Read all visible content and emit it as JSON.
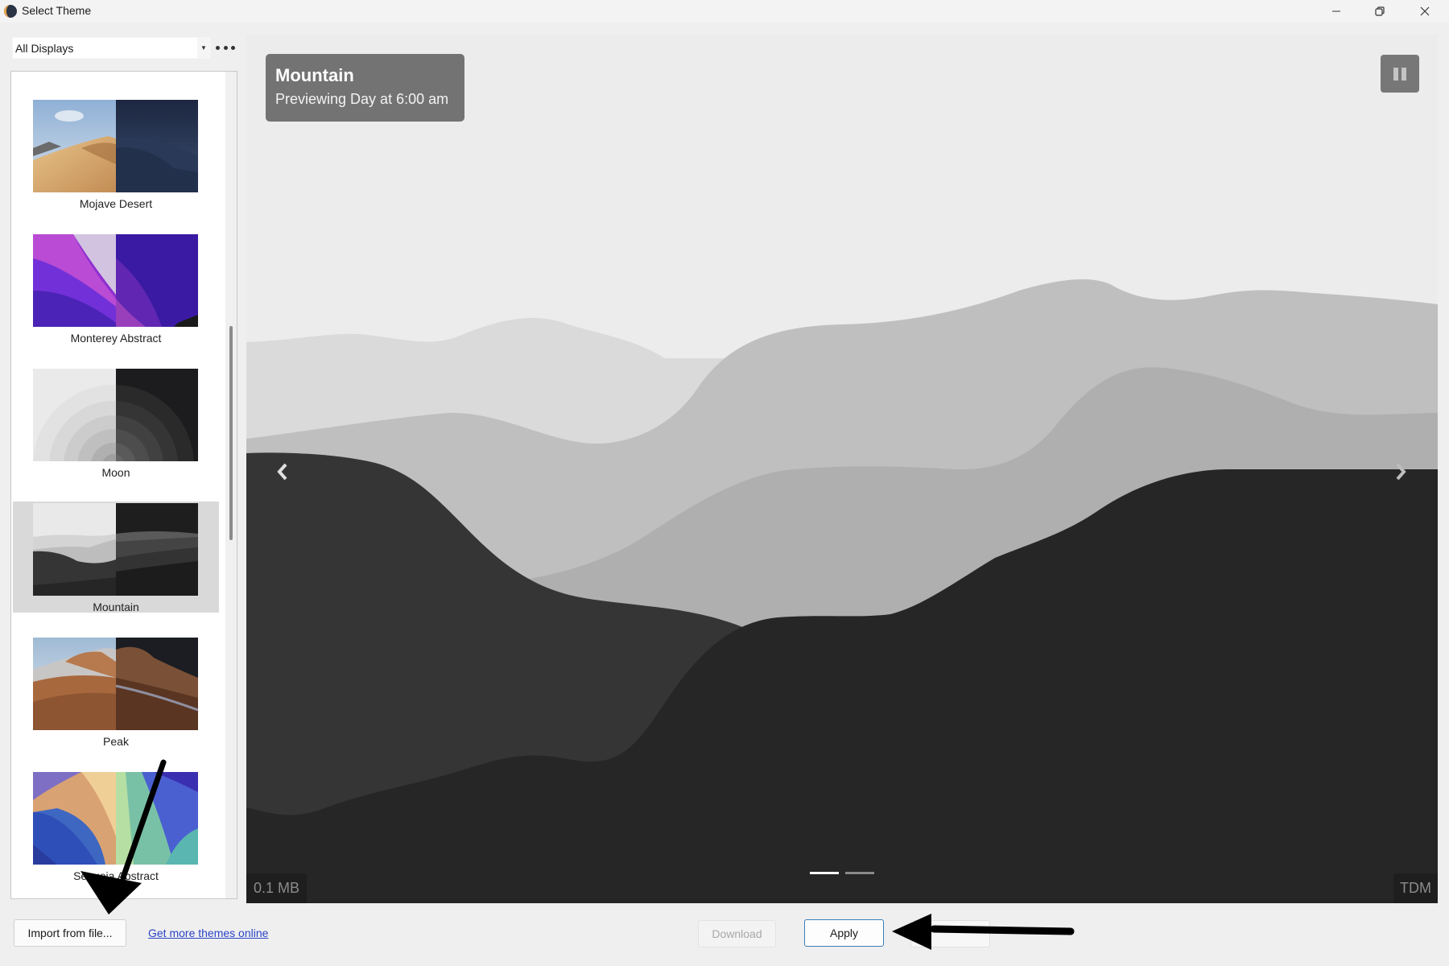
{
  "window": {
    "title": "Select Theme",
    "controls": [
      "minimize",
      "restore",
      "close"
    ]
  },
  "toolbar": {
    "display_select_value": "All Displays",
    "more_options_icon": "ellipsis-icon"
  },
  "theme_list": {
    "items": [
      {
        "label": "Mojave Desert",
        "selected": false
      },
      {
        "label": "Monterey Abstract",
        "selected": false
      },
      {
        "label": "Moon",
        "selected": false
      },
      {
        "label": "Mountain",
        "selected": true
      },
      {
        "label": "Peak",
        "selected": false
      },
      {
        "label": "Sequoia Abstract",
        "selected": false
      }
    ]
  },
  "preview": {
    "theme_name": "Mountain",
    "status": "Previewing Day at 6:00 am",
    "size": "0.1 MB",
    "author": "TDM",
    "slides_total": 2,
    "slide_active": 1,
    "pause_icon": "pause-icon",
    "prev_icon": "chevron-left-icon",
    "next_icon": "chevron-right-icon"
  },
  "footer": {
    "import_label": "Import from file...",
    "get_more_label": "Get more themes online",
    "download_label": "Download",
    "apply_label": "Apply",
    "cancel_label": ""
  },
  "colors": {
    "accent_border": "#3b7fb8",
    "link": "#2b44c9",
    "selected_item_bg": "#d9d9d9"
  }
}
